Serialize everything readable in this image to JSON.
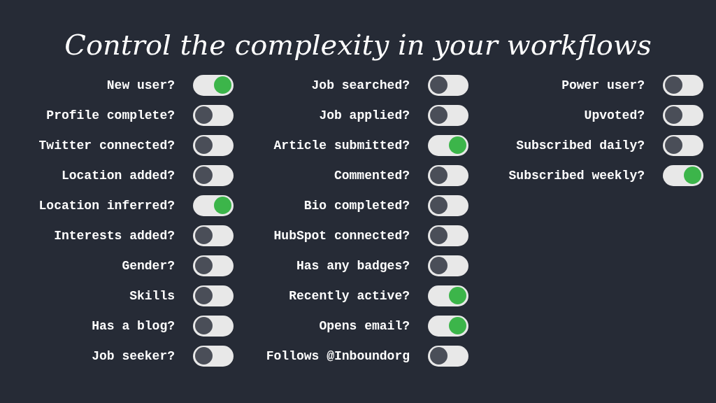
{
  "title": "Control the complexity in your workflows",
  "columns": [
    [
      {
        "label": "New user?",
        "on": true
      },
      {
        "label": "Profile complete?",
        "on": false
      },
      {
        "label": "Twitter connected?",
        "on": false
      },
      {
        "label": "Location added?",
        "on": false
      },
      {
        "label": "Location inferred?",
        "on": true
      },
      {
        "label": "Interests added?",
        "on": false
      },
      {
        "label": "Gender?",
        "on": false
      },
      {
        "label": "Skills",
        "on": false
      },
      {
        "label": "Has a blog?",
        "on": false
      },
      {
        "label": "Job seeker?",
        "on": false
      }
    ],
    [
      {
        "label": "Job searched?",
        "on": false
      },
      {
        "label": "Job applied?",
        "on": false
      },
      {
        "label": "Article submitted?",
        "on": true
      },
      {
        "label": "Commented?",
        "on": false
      },
      {
        "label": "Bio completed?",
        "on": false
      },
      {
        "label": "HubSpot connected?",
        "on": false
      },
      {
        "label": "Has any badges?",
        "on": false
      },
      {
        "label": "Recently active?",
        "on": true
      },
      {
        "label": "Opens email?",
        "on": true
      },
      {
        "label": "Follows @Inboundorg",
        "on": false
      }
    ],
    [
      {
        "label": "Power user?",
        "on": false
      },
      {
        "label": "Upvoted?",
        "on": false
      },
      {
        "label": "Subscribed daily?",
        "on": false
      },
      {
        "label": "Subscribed weekly?",
        "on": true
      }
    ]
  ]
}
